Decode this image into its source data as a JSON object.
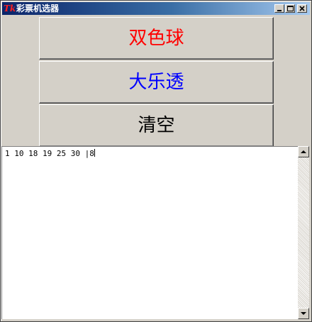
{
  "window": {
    "title": "彩票机选器"
  },
  "buttons": {
    "double_color_ball": {
      "label": "双色球",
      "color": "#ff0000"
    },
    "super_lotto": {
      "label": "大乐透",
      "color": "#0000ff"
    },
    "clear": {
      "label": "清空",
      "color": "#000000"
    }
  },
  "output": {
    "text": "1 10 18 19 25 30 |8"
  },
  "icons": {
    "app": "tk-icon",
    "minimize": "minimize-icon",
    "maximize": "maximize-icon",
    "close": "close-icon",
    "scroll_up": "scroll-up-arrow-icon",
    "scroll_down": "scroll-down-arrow-icon"
  }
}
